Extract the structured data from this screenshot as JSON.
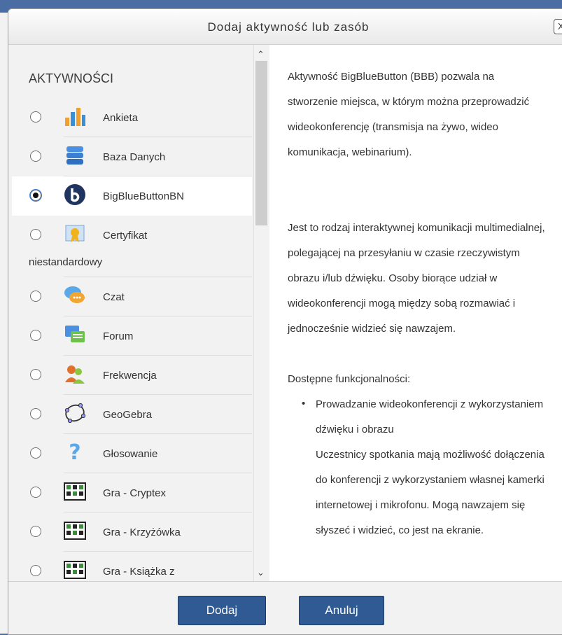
{
  "dialog": {
    "title": "Dodaj aktywność lub zasób",
    "close_label": "X"
  },
  "options": {
    "section_title": "AKTYWNOŚCI",
    "items": [
      {
        "label": "Ankieta",
        "icon": "bar-chart-icon",
        "selected": false
      },
      {
        "label": "Baza Danych",
        "icon": "database-icon",
        "selected": false
      },
      {
        "label": "BigBlueButtonBN",
        "icon": "bigbluebutton-icon",
        "selected": true
      },
      {
        "label": "Certyfikat",
        "label_cont": "niestandardowy",
        "icon": "certificate-icon",
        "selected": false
      },
      {
        "label": "Czat",
        "icon": "chat-icon",
        "selected": false
      },
      {
        "label": "Forum",
        "icon": "forum-icon",
        "selected": false
      },
      {
        "label": "Frekwencja",
        "icon": "attendance-icon",
        "selected": false
      },
      {
        "label": "GeoGebra",
        "icon": "geogebra-icon",
        "selected": false
      },
      {
        "label": "Głosowanie",
        "icon": "question-icon",
        "selected": false
      },
      {
        "label": "Gra - Cryptex",
        "icon": "game-grid-icon",
        "selected": false
      },
      {
        "label": "Gra - Krzyżówka",
        "icon": "game-grid-icon",
        "selected": false
      },
      {
        "label": "Gra - Książka z",
        "icon": "game-grid-icon",
        "selected": false
      }
    ]
  },
  "description": {
    "p1": "Aktywność BigBlueButton (BBB) pozwala na stworzenie miejsca, w którym można przeprowadzić wideokonferencję (transmisja na żywo, wideo komunikacja, webinarium).",
    "p2": "Jest to rodzaj interaktywnej komunikacji multimedialnej, polegającej na przesyłaniu w czasie rzeczywistym obrazu i/lub dźwięku. Osoby biorące udział w wideokonferencji mogą między sobą rozmawiać i jednocześnie widzieć się nawzajem.",
    "p3": "Dostępne funkcjonalności:",
    "li1": "Prowadzanie wideokonferencji z wykorzystaniem dźwięku i obrazu",
    "li1_detail": "Uczestnicy spotkania mają możliwość dołączenia do konferencji z wykorzystaniem własnej kamerki internetowej i mikrofonu. Mogą nawzajem się słyszeć i widzieć, co jest na ekranie."
  },
  "footer": {
    "add_label": "Dodaj",
    "cancel_label": "Anuluj"
  },
  "colors": {
    "primary_button": "#2f5a94",
    "panel_bg": "#f2f2f2"
  }
}
